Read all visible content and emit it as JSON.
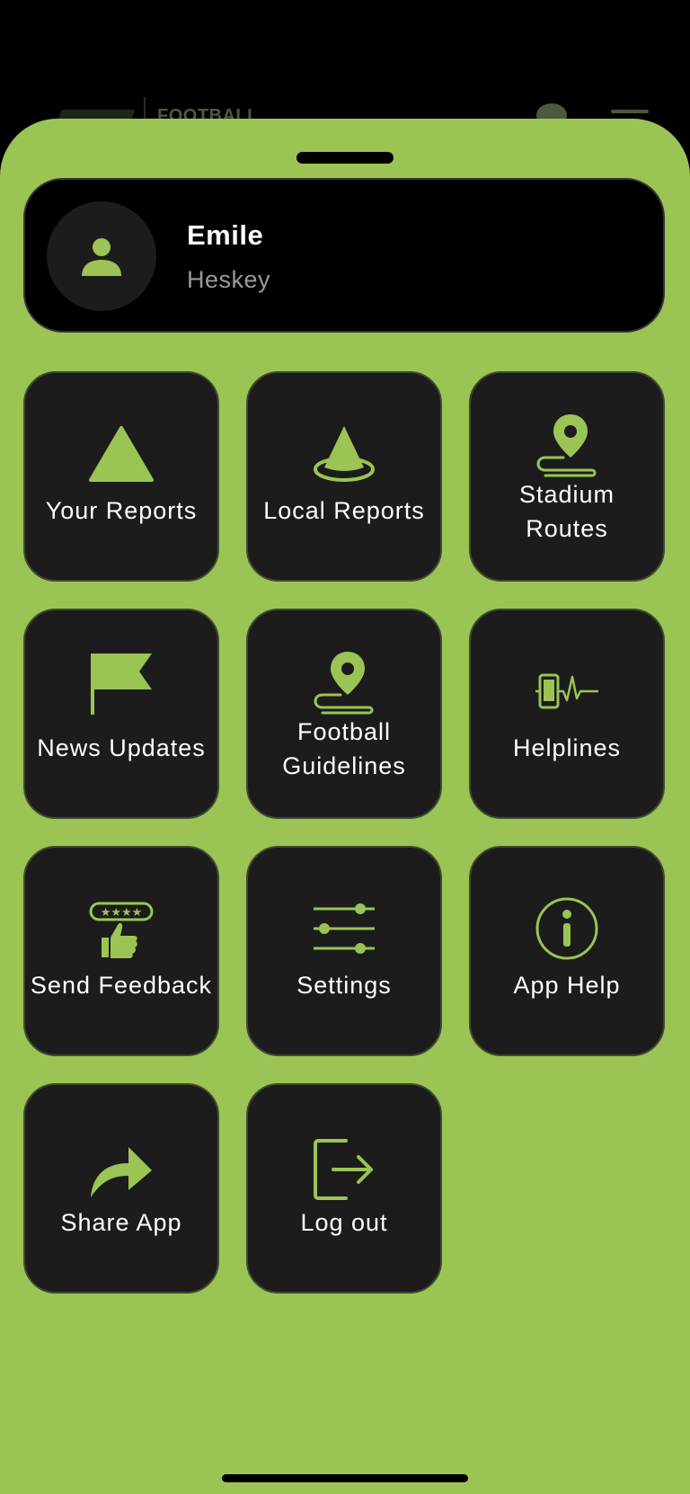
{
  "app": {
    "brand_text": "FOOTBALL",
    "accent_color": "#9bc455",
    "tile_color": "#1c1c1c"
  },
  "profile": {
    "first_name": "Emile",
    "last_name": "Heskey",
    "avatar_icon": "person-icon"
  },
  "menu": {
    "items": [
      {
        "label": "Your Reports",
        "icon": "warning-triangle-icon"
      },
      {
        "label": "Local Reports",
        "icon": "cone-icon"
      },
      {
        "label_line1": "Stadium",
        "label_line2": "Routes",
        "icon": "route-pin-icon"
      },
      {
        "label": "News Updates",
        "icon": "flag-icon"
      },
      {
        "label_line1": "Football",
        "label_line2": "Guidelines",
        "icon": "route-pin-icon"
      },
      {
        "label": "Helplines",
        "icon": "phone-pulse-icon"
      },
      {
        "label": "Send Feedback",
        "icon": "feedback-thumbs-up-icon"
      },
      {
        "label": "Settings",
        "icon": "sliders-icon"
      },
      {
        "label": "App Help",
        "icon": "info-icon"
      },
      {
        "label": "Share App",
        "icon": "share-arrow-icon"
      },
      {
        "label": "Log out",
        "icon": "logout-icon"
      }
    ]
  }
}
